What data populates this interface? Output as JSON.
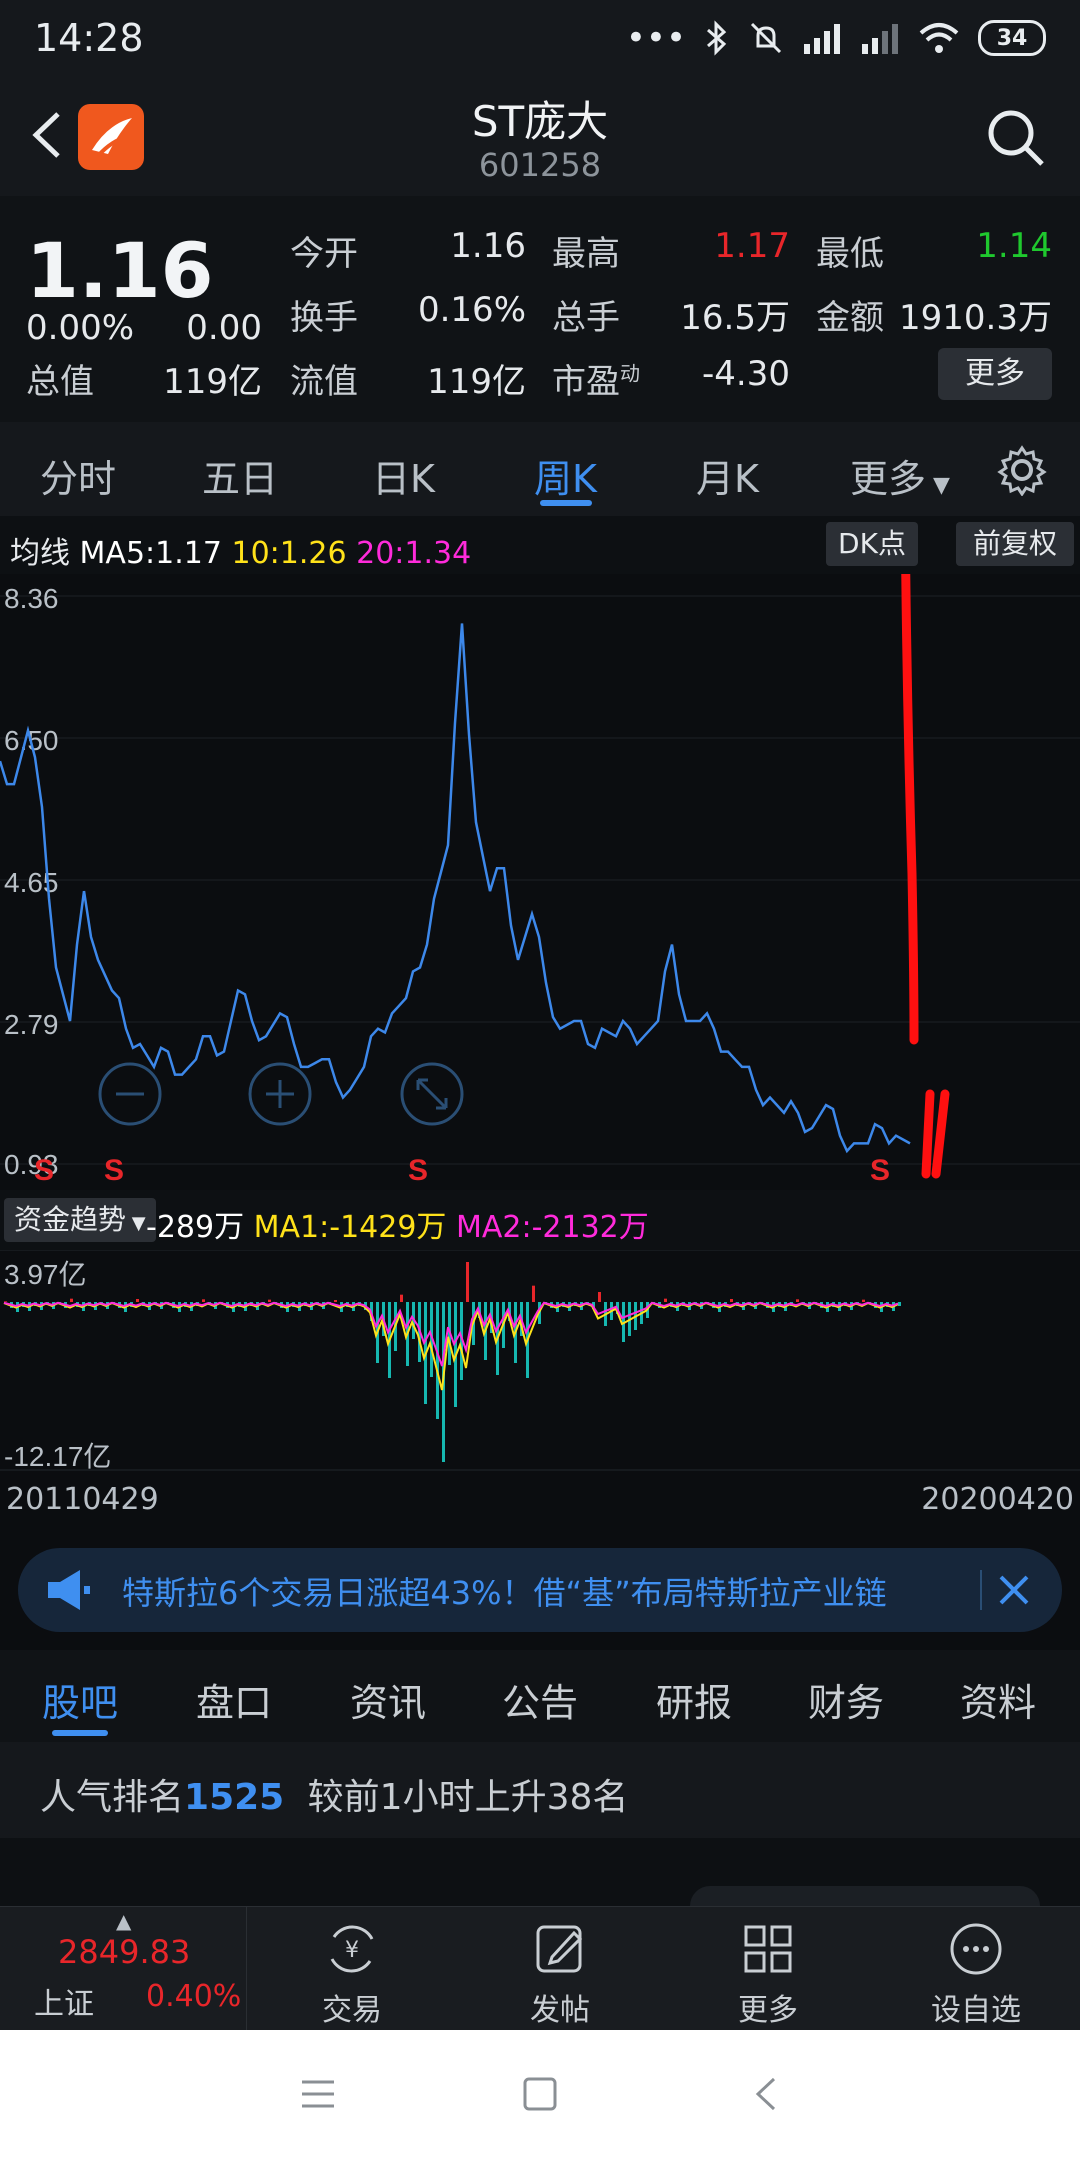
{
  "status": {
    "time": "14:28",
    "battery": "34"
  },
  "header": {
    "stock_name": "ST庞大",
    "stock_code": "601258"
  },
  "quote": {
    "price": "1.16",
    "change_pct": "0.00%",
    "change_amt": "0.00",
    "market_cap_label": "总值",
    "market_cap": "119亿",
    "open_label": "今开",
    "open": "1.16",
    "turnover_label": "换手",
    "turnover": "0.16%",
    "float_cap_label": "流值",
    "float_cap": "119亿",
    "high_label": "最高",
    "high": "1.17",
    "volume_label": "总手",
    "volume": "16.5万",
    "pe_label": "市盈",
    "pe_sup": "动",
    "pe": "-4.30",
    "low_label": "最低",
    "low": "1.14",
    "amount_label": "金额",
    "amount": "1910.3万",
    "more_label": "更多",
    "colors": {
      "up": "#e8262a",
      "down": "#1fc82e"
    }
  },
  "period_tabs": [
    "分时",
    "五日",
    "日K",
    "周K",
    "月K",
    "更多"
  ],
  "active_period": "周K",
  "ma": {
    "label": "均线",
    "ma5": "MA5:1.17",
    "ma10": "10:1.26",
    "ma20": "20:1.34",
    "dk_label": "DK点",
    "adjust_label": "前复权",
    "colors": {
      "ma5": "#ffffff",
      "ma10": "#ffe21a",
      "ma20": "#ff2bdb"
    }
  },
  "fund": {
    "selector": "资金趋势",
    "value": "-289万",
    "ma1": "MA1:-1429万",
    "ma2": "MA2:-2132万"
  },
  "chart_data": [
    {
      "type": "line",
      "y_ticks": [
        "8.36",
        "6.50",
        "4.65",
        "2.79",
        "0.93"
      ],
      "ylim": [
        0.93,
        8.36
      ],
      "signals": [
        "S",
        "S",
        "S",
        "S"
      ],
      "series": [
        {
          "values": [
            6.2,
            5.9,
            6.6,
            5.6,
            3.5,
            2.8,
            4.5,
            3.6,
            3.2,
            2.7,
            2.5,
            2.2,
            2.4,
            2.1,
            2.3,
            2.6,
            2.4,
            3.2,
            2.8,
            2.6,
            2.9,
            2.5,
            2.2,
            2.3,
            2.0,
            1.9,
            2.2,
            2.7,
            2.9,
            3.1,
            3.5,
            4.4,
            5.1,
            8.0,
            5.4,
            4.5,
            4.8,
            3.6,
            4.2,
            3.3,
            2.7,
            2.8,
            2.5,
            2.7,
            2.6,
            2.7,
            2.6,
            2.8,
            3.8,
            2.8,
            2.8,
            2.7,
            2.4,
            2.2,
            1.9,
            1.8,
            1.6,
            1.6,
            1.4,
            1.7,
            1.3,
            1.2,
            1.2,
            1.4,
            1.3,
            1.2
          ]
        }
      ]
    },
    {
      "type": "bar",
      "y_ticks": [
        "3.97亿",
        "-12.17亿"
      ],
      "ylim": [
        -12.17,
        3.97
      ],
      "x_range": [
        "20110429",
        "20200420"
      ]
    }
  ],
  "news": {
    "text": "特斯拉6个交易日涨超43%！借“基”布局特斯拉产业链"
  },
  "content_tabs": [
    "股吧",
    "盘口",
    "资讯",
    "公告",
    "研报",
    "财务",
    "资料"
  ],
  "ranking": {
    "prefix": "人气排名",
    "rank": "1525",
    "suffix": "较前1小时上升38名"
  },
  "bottom_bar": {
    "index_value": "2849.83",
    "index_name": "上证",
    "index_change": "0.40%",
    "items": [
      "交易",
      "发帖",
      "更多",
      "设自选"
    ]
  }
}
